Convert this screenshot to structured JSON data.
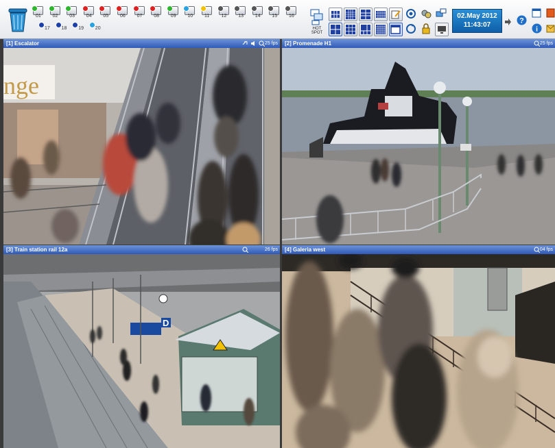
{
  "clock": {
    "date": "02.May 2012",
    "time": "11:43:07"
  },
  "toolbar": {
    "hotspot_label": "HOT SPOT",
    "cameras_row1": [
      {
        "num": "01",
        "color": "#2db52d"
      },
      {
        "num": "02",
        "color": "#2db52d"
      },
      {
        "num": "03",
        "color": "#2db52d"
      },
      {
        "num": "04",
        "color": "#d22"
      },
      {
        "num": "05",
        "color": "#d22"
      },
      {
        "num": "06",
        "color": "#d22"
      },
      {
        "num": "07",
        "color": "#d22"
      },
      {
        "num": "08",
        "color": "#d22"
      },
      {
        "num": "09",
        "color": "#2db52d"
      },
      {
        "num": "10",
        "color": "#29a3e0"
      },
      {
        "num": "11",
        "color": "#f2c200"
      },
      {
        "num": "12",
        "color": "#555"
      },
      {
        "num": "13",
        "color": "#555"
      },
      {
        "num": "14",
        "color": "#555"
      },
      {
        "num": "15",
        "color": "#555"
      },
      {
        "num": "16",
        "color": "#555"
      }
    ],
    "cameras_row2": [
      {
        "num": "17",
        "color": "#1d3fa8"
      },
      {
        "num": "18",
        "color": "#1d3fa8"
      },
      {
        "num": "19",
        "color": "#1d3fa8"
      },
      {
        "num": "20",
        "color": "#29a3e0"
      }
    ]
  },
  "tiles": [
    {
      "title": "[1] Escalator",
      "fps": "25 fps"
    },
    {
      "title": "[2] Promenade H1",
      "fps": "25 fps"
    },
    {
      "title": "[3] Train station  rail 12a",
      "fps": "26 fps"
    },
    {
      "title": "[4] Galeria west",
      "fps": "04 fps"
    }
  ],
  "scene_text": {
    "store_sign": "nge",
    "platform_letter": "D"
  },
  "colors": {
    "title_bar": "#3d67c2",
    "clock_bg": "#1a73c0"
  },
  "icons": [
    "trash-icon",
    "hotspot-icon",
    "layout-2x2-icon",
    "layout-3x3-icon",
    "layout-4x4-icon",
    "layout-single-icon",
    "edit-icon",
    "settings-icon",
    "tools-icon",
    "network-icon",
    "lock-icon",
    "mail-icon",
    "monitor-icon",
    "help-icon",
    "info-icon",
    "window-icon",
    "arrow-right-icon",
    "zoom-icon",
    "audio-icon"
  ]
}
